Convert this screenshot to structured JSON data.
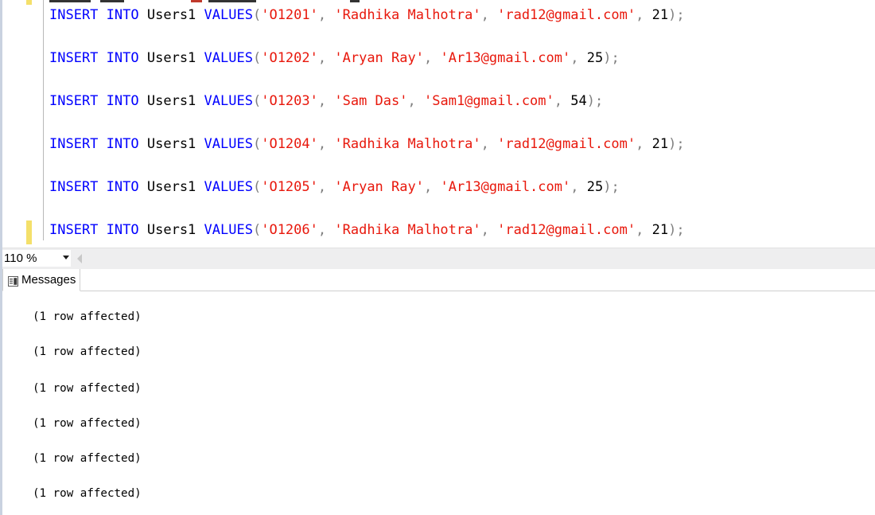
{
  "editor": {
    "lines": [
      {
        "keyword_insert": "INSERT",
        "keyword_into": "INTO",
        "table": "Users1",
        "keyword_values": "VALUES",
        "open_paren": "(",
        "id": "'O1201'",
        "name": "'Radhika Malhotra'",
        "email": "'rad12@gmail.com'",
        "age": "21",
        "close": ");",
        "comma": ","
      },
      {
        "keyword_insert": "INSERT",
        "keyword_into": "INTO",
        "table": "Users1",
        "keyword_values": "VALUES",
        "open_paren": "(",
        "id": "'O1202'",
        "name": "'Aryan Ray'",
        "email": "'Ar13@gmail.com'",
        "age": "25",
        "close": ");",
        "comma": ","
      },
      {
        "keyword_insert": "INSERT",
        "keyword_into": "INTO",
        "table": "Users1",
        "keyword_values": "VALUES",
        "open_paren": "(",
        "id": "'O1203'",
        "name": "'Sam Das'",
        "email": "'Sam1@gmail.com'",
        "age": "54",
        "close": ");",
        "comma": ","
      },
      {
        "keyword_insert": "INSERT",
        "keyword_into": "INTO",
        "table": "Users1",
        "keyword_values": "VALUES",
        "open_paren": "(",
        "id": "'O1204'",
        "name": "'Radhika Malhotra'",
        "email": "'rad12@gmail.com'",
        "age": "21",
        "close": ");",
        "comma": ","
      },
      {
        "keyword_insert": "INSERT",
        "keyword_into": "INTO",
        "table": "Users1",
        "keyword_values": "VALUES",
        "open_paren": "(",
        "id": "'O1205'",
        "name": "'Aryan Ray'",
        "email": "'Ar13@gmail.com'",
        "age": "25",
        "close": ");",
        "comma": ","
      },
      {
        "keyword_insert": "INSERT",
        "keyword_into": "INTO",
        "table": "Users1",
        "keyword_values": "VALUES",
        "open_paren": "(",
        "id": "'O1206'",
        "name": "'Radhika Malhotra'",
        "email": "'rad12@gmail.com'",
        "age": "21",
        "close": ");",
        "comma": ","
      }
    ]
  },
  "zoom": {
    "value": "110 %"
  },
  "results": {
    "tab_label": "Messages",
    "messages": [
      "(1 row affected)",
      "(1 row affected)",
      "(1 row affected)",
      "(1 row affected)",
      "(1 row affected)",
      "(1 row affected)"
    ]
  },
  "colors": {
    "keyword": "#0000ff",
    "string": "#e8180c",
    "punctuation": "#808080",
    "change_marker": "#f4e06a"
  },
  "icons": {
    "messages_tab": "messages-icon",
    "zoom_dropdown": "chevron-down-icon",
    "scroll_left": "scroll-left-icon"
  }
}
